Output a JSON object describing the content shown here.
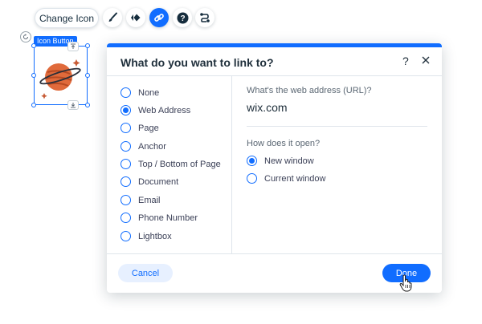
{
  "toolbar": {
    "change_icon_label": "Change Icon",
    "tools": [
      {
        "name": "design",
        "icon": "paintbrush-icon"
      },
      {
        "name": "animation",
        "icon": "animation-icon"
      },
      {
        "name": "link",
        "icon": "link-icon",
        "active": true
      },
      {
        "name": "help",
        "icon": "question-icon"
      },
      {
        "name": "connect",
        "icon": "connect-icon"
      }
    ]
  },
  "canvas": {
    "selection_label": "Icon Button"
  },
  "dialog": {
    "title": "What do you want to link to?",
    "help_label": "?",
    "link_types": [
      {
        "label": "None",
        "selected": false
      },
      {
        "label": "Web Address",
        "selected": true
      },
      {
        "label": "Page",
        "selected": false
      },
      {
        "label": "Anchor",
        "selected": false
      },
      {
        "label": "Top / Bottom of Page",
        "selected": false
      },
      {
        "label": "Document",
        "selected": false
      },
      {
        "label": "Email",
        "selected": false
      },
      {
        "label": "Phone Number",
        "selected": false
      },
      {
        "label": "Lightbox",
        "selected": false
      }
    ],
    "url_label": "What's the web address (URL)?",
    "url_value": "wix.com",
    "open_label": "How does it open?",
    "open_options": [
      {
        "label": "New window",
        "selected": true
      },
      {
        "label": "Current window",
        "selected": false
      }
    ],
    "cancel_label": "Cancel",
    "done_label": "Done"
  },
  "colors": {
    "accent": "#116dff",
    "accent_light": "#e7f0ff",
    "text": "#20303c",
    "divider": "#dfe5eb"
  }
}
